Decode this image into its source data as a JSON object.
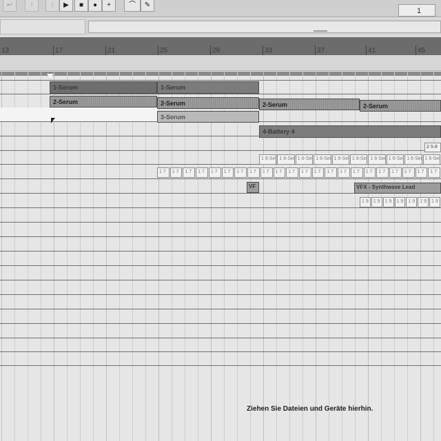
{
  "transport": {
    "buttons": [
      {
        "id": "b1",
        "label": "↩",
        "faint": true
      },
      {
        "id": "b2",
        "label": "↑",
        "faint": true
      },
      {
        "id": "b3",
        "label": "↑",
        "faint": true
      },
      {
        "id": "play",
        "label": "▶",
        "faint": false
      },
      {
        "id": "stop",
        "label": "■",
        "faint": false
      },
      {
        "id": "record",
        "label": "●",
        "faint": false
      },
      {
        "id": "overdub",
        "label": "+",
        "faint": false
      },
      {
        "id": "auto",
        "label": "⌒",
        "faint": false
      },
      {
        "id": "draw",
        "label": "✎",
        "faint": false
      }
    ],
    "counter_value": "1"
  },
  "ruler": {
    "ticks": [
      "13",
      "17",
      "21",
      "25",
      "29",
      "33",
      "37",
      "41",
      "45"
    ]
  },
  "tracks": {
    "row1": {
      "clips": [
        "1-Serum",
        "1-Serum"
      ]
    },
    "row2": {
      "clips": [
        "2-Serum",
        "2-Serum",
        "2-Serum",
        "2-Serum"
      ]
    },
    "row3": {
      "clips": [
        "3-Serum"
      ]
    },
    "row4": {
      "clips": [
        "4-Battery 4"
      ]
    },
    "row5": {
      "clips": [
        "2 5-8"
      ]
    },
    "row6": {
      "clip_label": "1 6-Ser",
      "count": 10
    },
    "row7": {
      "clip_label": "1 7",
      "count": 22
    },
    "row8": {
      "clips": [
        "VF",
        "VFX - Synthwave Lead"
      ]
    },
    "row9": {
      "clip_label": "1 9",
      "count": 7
    }
  },
  "drop_zone": {
    "text": "Ziehen Sie Dateien und Geräte hierhin."
  },
  "colors": {
    "ruler": "#6c6c6c",
    "clip_dark": "#6e6e6e",
    "clip_mid": "#9b9b9b",
    "background": "#e6e6e6"
  }
}
